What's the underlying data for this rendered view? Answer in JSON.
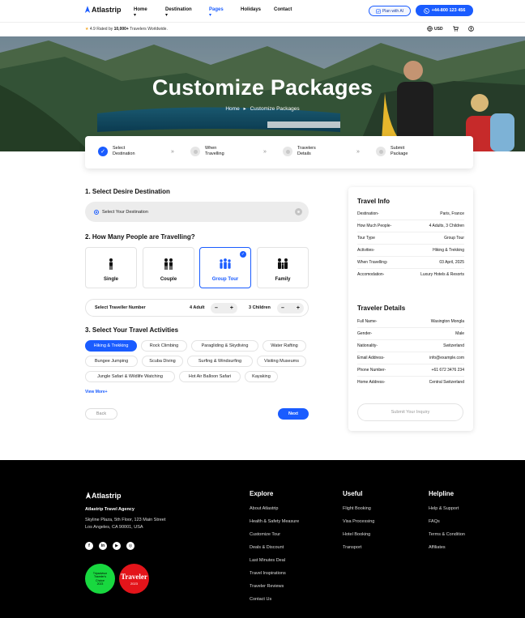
{
  "header": {
    "brand": "Atlastrip",
    "nav": [
      {
        "label": "Home ▾"
      },
      {
        "label": "Destination ▾"
      },
      {
        "label": "Pages ▾"
      },
      {
        "label": "Holidays"
      },
      {
        "label": "Contact"
      }
    ],
    "plan_button": "Plan with AI",
    "phone_button": "+44-800 123 456"
  },
  "subbar": {
    "rating_prefix": "4.9 Rated by",
    "rating_count": "10,000+",
    "rating_suffix": "Travelers Worldwide.",
    "currency": "USD"
  },
  "hero": {
    "title": "Customize Packages",
    "breadcrumb_home": "Home",
    "breadcrumb_sep": "▸",
    "breadcrumb_current": "Customize Packages"
  },
  "steps": [
    {
      "line1": "Select",
      "line2": "Destination",
      "active": true
    },
    {
      "line1": "When",
      "line2": "Travelling",
      "active": false
    },
    {
      "line1": "Travelers",
      "line2": "Details",
      "active": false
    },
    {
      "line1": "Submit",
      "line2": "Package",
      "active": false
    }
  ],
  "step_arrow": "»",
  "form": {
    "section1_title": "1.  Select Desire Destination",
    "destination_placeholder": "Select Your Destination",
    "section2_title": "2.  How Many People are Travelling?",
    "people_options": [
      {
        "label": "Single",
        "icon": "person-icon",
        "glyph": "🚶"
      },
      {
        "label": "Couple",
        "icon": "couple-icon",
        "glyph": "👫"
      },
      {
        "label": "Group Tour",
        "icon": "group-icon",
        "glyph": "👪"
      },
      {
        "label": "Family",
        "icon": "family-icon",
        "glyph": "👨‍👩‍👧"
      }
    ],
    "selected_people": "Group Tour",
    "traveler_number_label": "Select Traveller Number",
    "adult_label": "4 Adult",
    "children_label": "3 Children",
    "minus": "–",
    "plus": "+",
    "section3_title": "3.  Select Your Travel Activities",
    "activities": [
      "Hiking & Trekking",
      "Rock Climbing",
      "Paragliding & Skydiving",
      "Water Rafting",
      "Bungee Jumping",
      "Scuba Diving",
      "Surfing & Windsurfing",
      "Visiting Museums",
      "Jungle Safari & Wildlife Watching",
      "Hot Air Balloon Safari",
      "Kayaking"
    ],
    "active_activity": "Hiking & Trekking",
    "view_more": "View More+",
    "back_label": "Back",
    "next_label": "Next"
  },
  "travel_info": {
    "title": "Travel Info",
    "rows": [
      {
        "label": "Destination-",
        "value": "Paris, France"
      },
      {
        "label": "How Much People-",
        "value": "4 Adults, 3 Children"
      },
      {
        "label": "Tour Type",
        "value": "Group Tour"
      },
      {
        "label": "Activities-",
        "value": "Hiking & Trekking"
      },
      {
        "label": "When Travelling-",
        "value": "03 April, 2025"
      },
      {
        "label": "Accomodation-",
        "value": "Luxury Hotels & Resorts"
      }
    ]
  },
  "traveler_details": {
    "title": "Traveler Details",
    "rows": [
      {
        "label": "Full Name-",
        "value": "Wasington Mongla"
      },
      {
        "label": "Gender-",
        "value": "Male"
      },
      {
        "label": "Nationality-",
        "value": "Switzerland"
      },
      {
        "label": "Email Address-",
        "value": "info@example.com"
      },
      {
        "label": "Phone Number-",
        "value": "+61 672 3476 234"
      },
      {
        "label": "Home Address-",
        "value": "Central Switzerland"
      }
    ],
    "submit_label": "Submit Your Inquiry"
  },
  "footer": {
    "brand": "Atlastrip",
    "agency": "Atlastrip Travel Agency",
    "address_line1": "Skyline Plaza, 5th Floor, 123 Main Street",
    "address_line2": "Los Angeles, CA 90001, USA",
    "social": [
      {
        "icon": "facebook-icon",
        "glyph": "f"
      },
      {
        "icon": "linkedin-icon",
        "glyph": "in"
      },
      {
        "icon": "youtube-icon",
        "glyph": "▶"
      },
      {
        "icon": "instagram-icon",
        "glyph": "◎"
      }
    ],
    "badge_green": [
      "Tripadvisor",
      "Traveler's",
      "Choice",
      "2023"
    ],
    "badge_red_big": "Traveler",
    "badge_red_year": "2023",
    "columns": [
      {
        "title": "Explore",
        "links": [
          "About Atlastrip",
          "Health & Safety Measure",
          "Customize Tour",
          "Deals & Discount",
          "Last Minutes Deal",
          "Travel Inspirations",
          "Traveler Reviews",
          "Contact Us"
        ]
      },
      {
        "title": "Useful",
        "links": [
          "Flight Booking",
          "Visa Processing",
          "Hotel Booking",
          "Transport"
        ]
      },
      {
        "title": "Helpline",
        "links": [
          "Help & Support",
          "FAQs",
          "Terms & Condition",
          "Affiliates"
        ]
      }
    ]
  },
  "colors": {
    "accent": "#1a5cff",
    "footer_bg": "#000000",
    "badge_green": "#18d83f",
    "badge_red": "#e3141a"
  }
}
